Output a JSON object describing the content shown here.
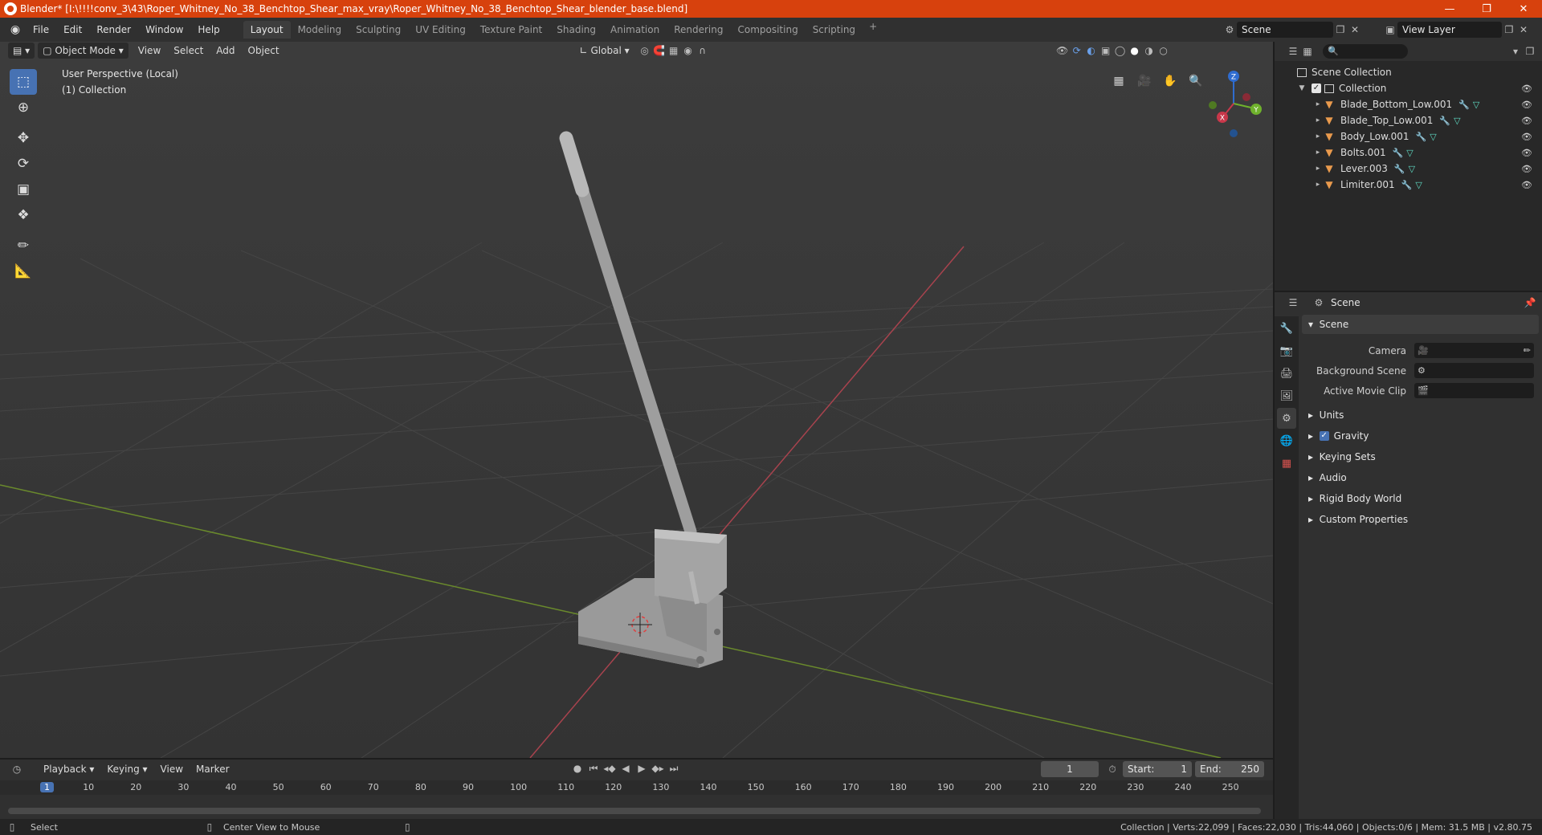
{
  "window": {
    "title": "Blender* [I:\\!!!!conv_3\\43\\Roper_Whitney_No_38_Benchtop_Shear_max_vray\\Roper_Whitney_No_38_Benchtop_Shear_blender_base.blend]"
  },
  "menubar": {
    "items": [
      "File",
      "Edit",
      "Render",
      "Window",
      "Help"
    ],
    "workspaces": [
      "Layout",
      "Modeling",
      "Sculpting",
      "UV Editing",
      "Texture Paint",
      "Shading",
      "Animation",
      "Rendering",
      "Compositing",
      "Scripting"
    ],
    "active_workspace": "Layout",
    "scene": "Scene",
    "view_layer": "View Layer"
  },
  "viewport": {
    "mode": "Object Mode",
    "menus": [
      "View",
      "Select",
      "Add",
      "Object"
    ],
    "orientation": "Global",
    "overlay_line1": "User Perspective (Local)",
    "overlay_line2": "(1) Collection",
    "gizmo_axes": {
      "x": "X",
      "y": "Y",
      "z": "Z"
    }
  },
  "outliner": {
    "root": "Scene Collection",
    "collection": "Collection",
    "objects": [
      "Blade_Bottom_Low.001",
      "Blade_Top_Low.001",
      "Body_Low.001",
      "Bolts.001",
      "Lever.003",
      "Limiter.001"
    ]
  },
  "properties": {
    "header": "Scene",
    "section": "Scene",
    "fields": {
      "camera": "Camera",
      "background_scene": "Background Scene",
      "active_movie_clip": "Active Movie Clip"
    },
    "panels": [
      "Units",
      "Gravity",
      "Keying Sets",
      "Audio",
      "Rigid Body World",
      "Custom Properties"
    ]
  },
  "timeline": {
    "menus": [
      "Playback",
      "Keying",
      "View",
      "Marker"
    ],
    "current_frame": "1",
    "start_label": "Start:",
    "start": "1",
    "end_label": "End:",
    "end": "250",
    "ticks": [
      "10",
      "20",
      "30",
      "40",
      "50",
      "60",
      "70",
      "80",
      "90",
      "100",
      "110",
      "120",
      "130",
      "140",
      "150",
      "160",
      "170",
      "180",
      "190",
      "200",
      "210",
      "220",
      "230",
      "240",
      "250"
    ]
  },
  "statusbar": {
    "left": "Select",
    "middle": "Center View to Mouse",
    "right": "Collection | Verts:22,099 | Faces:22,030 | Tris:44,060 | Objects:0/6 | Mem: 31.5 MB | v2.80.75"
  }
}
